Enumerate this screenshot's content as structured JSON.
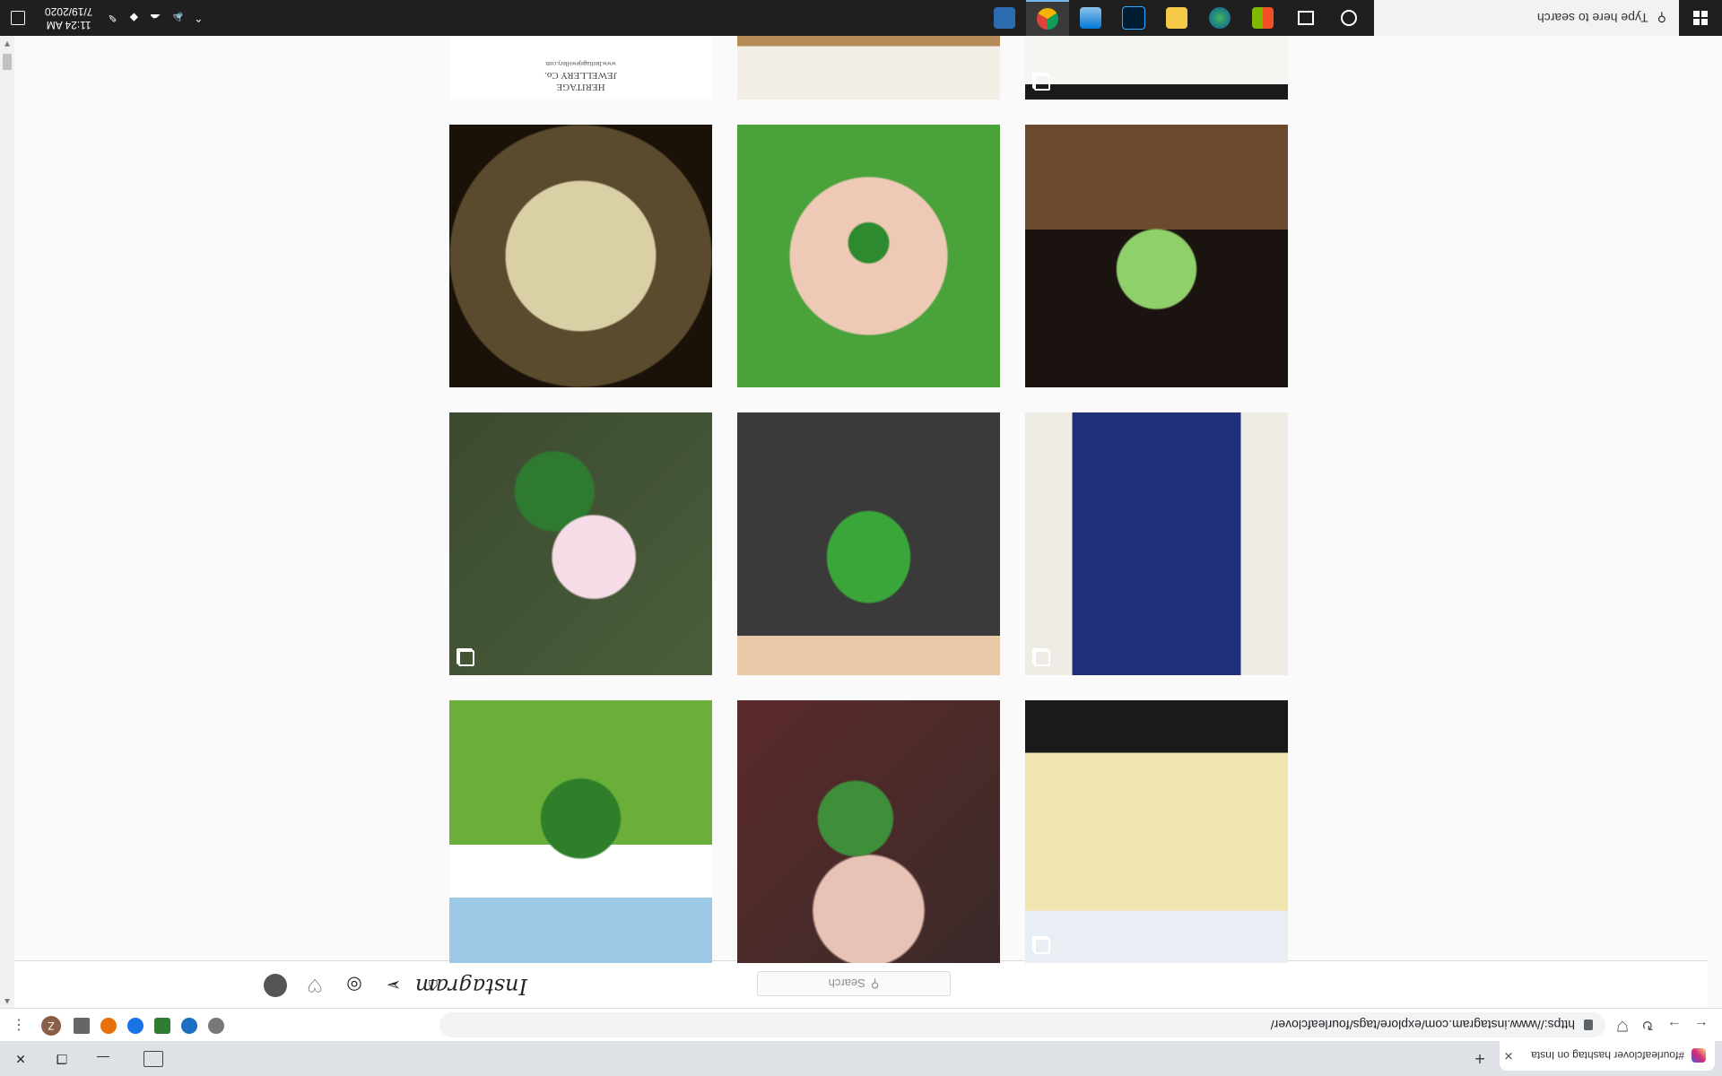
{
  "browser": {
    "tab_title": "#fourleafclover hashtag on Insta",
    "tab_close": "✕",
    "new_tab": "+",
    "url": "https://www.instagram.com/explore/tags/fourleafclover/",
    "back": "←",
    "forward": "→",
    "reload": "↻",
    "menu": "⋮",
    "profile_initial": "Z",
    "window": {
      "minimize": "—",
      "restore": "❐",
      "close": "✕"
    }
  },
  "instagram": {
    "logo": "Instagram",
    "search_placeholder": "Search",
    "nav_icons": [
      "home-icon",
      "direct-icon",
      "explore-icon",
      "activity-icon",
      "profile-avatar"
    ]
  },
  "grid": {
    "posts": [
      {
        "name": "post-jewelry",
        "multi": true
      },
      {
        "name": "post-sketch",
        "multi": false
      },
      {
        "name": "post-art-top",
        "multi": true
      },
      {
        "name": "post-clover-fence",
        "multi": false
      },
      {
        "name": "post-clover-dark",
        "multi": false
      },
      {
        "name": "post-art-tamago",
        "multi": true
      },
      {
        "name": "post-pink-flower",
        "multi": true
      },
      {
        "name": "post-clovers-row",
        "multi": false
      },
      {
        "name": "post-lucky-banner",
        "multi": true
      },
      {
        "name": "post-pressed-clover",
        "multi": false
      },
      {
        "name": "post-hands-clover",
        "multi": false
      },
      {
        "name": "post-green-dome",
        "multi": false
      }
    ],
    "jewelry_text": [
      "HERITAGE",
      "JEWELLERY Co.",
      "www.heritagejewellery.com"
    ]
  },
  "taskbar": {
    "search_placeholder": "Type here to search",
    "time": "11:24 AM",
    "date": "7/19/2020",
    "apps": [
      "cortana-icon",
      "task-view-icon",
      "store-icon",
      "edge-icon",
      "file-explorer-icon",
      "photoshop-icon",
      "photos-icon",
      "chrome-icon",
      "control-panel-icon"
    ]
  },
  "colors": {
    "ig_bg": "#fafafa",
    "taskbar": "#1f1f1f",
    "accent": "#76b9ed"
  }
}
